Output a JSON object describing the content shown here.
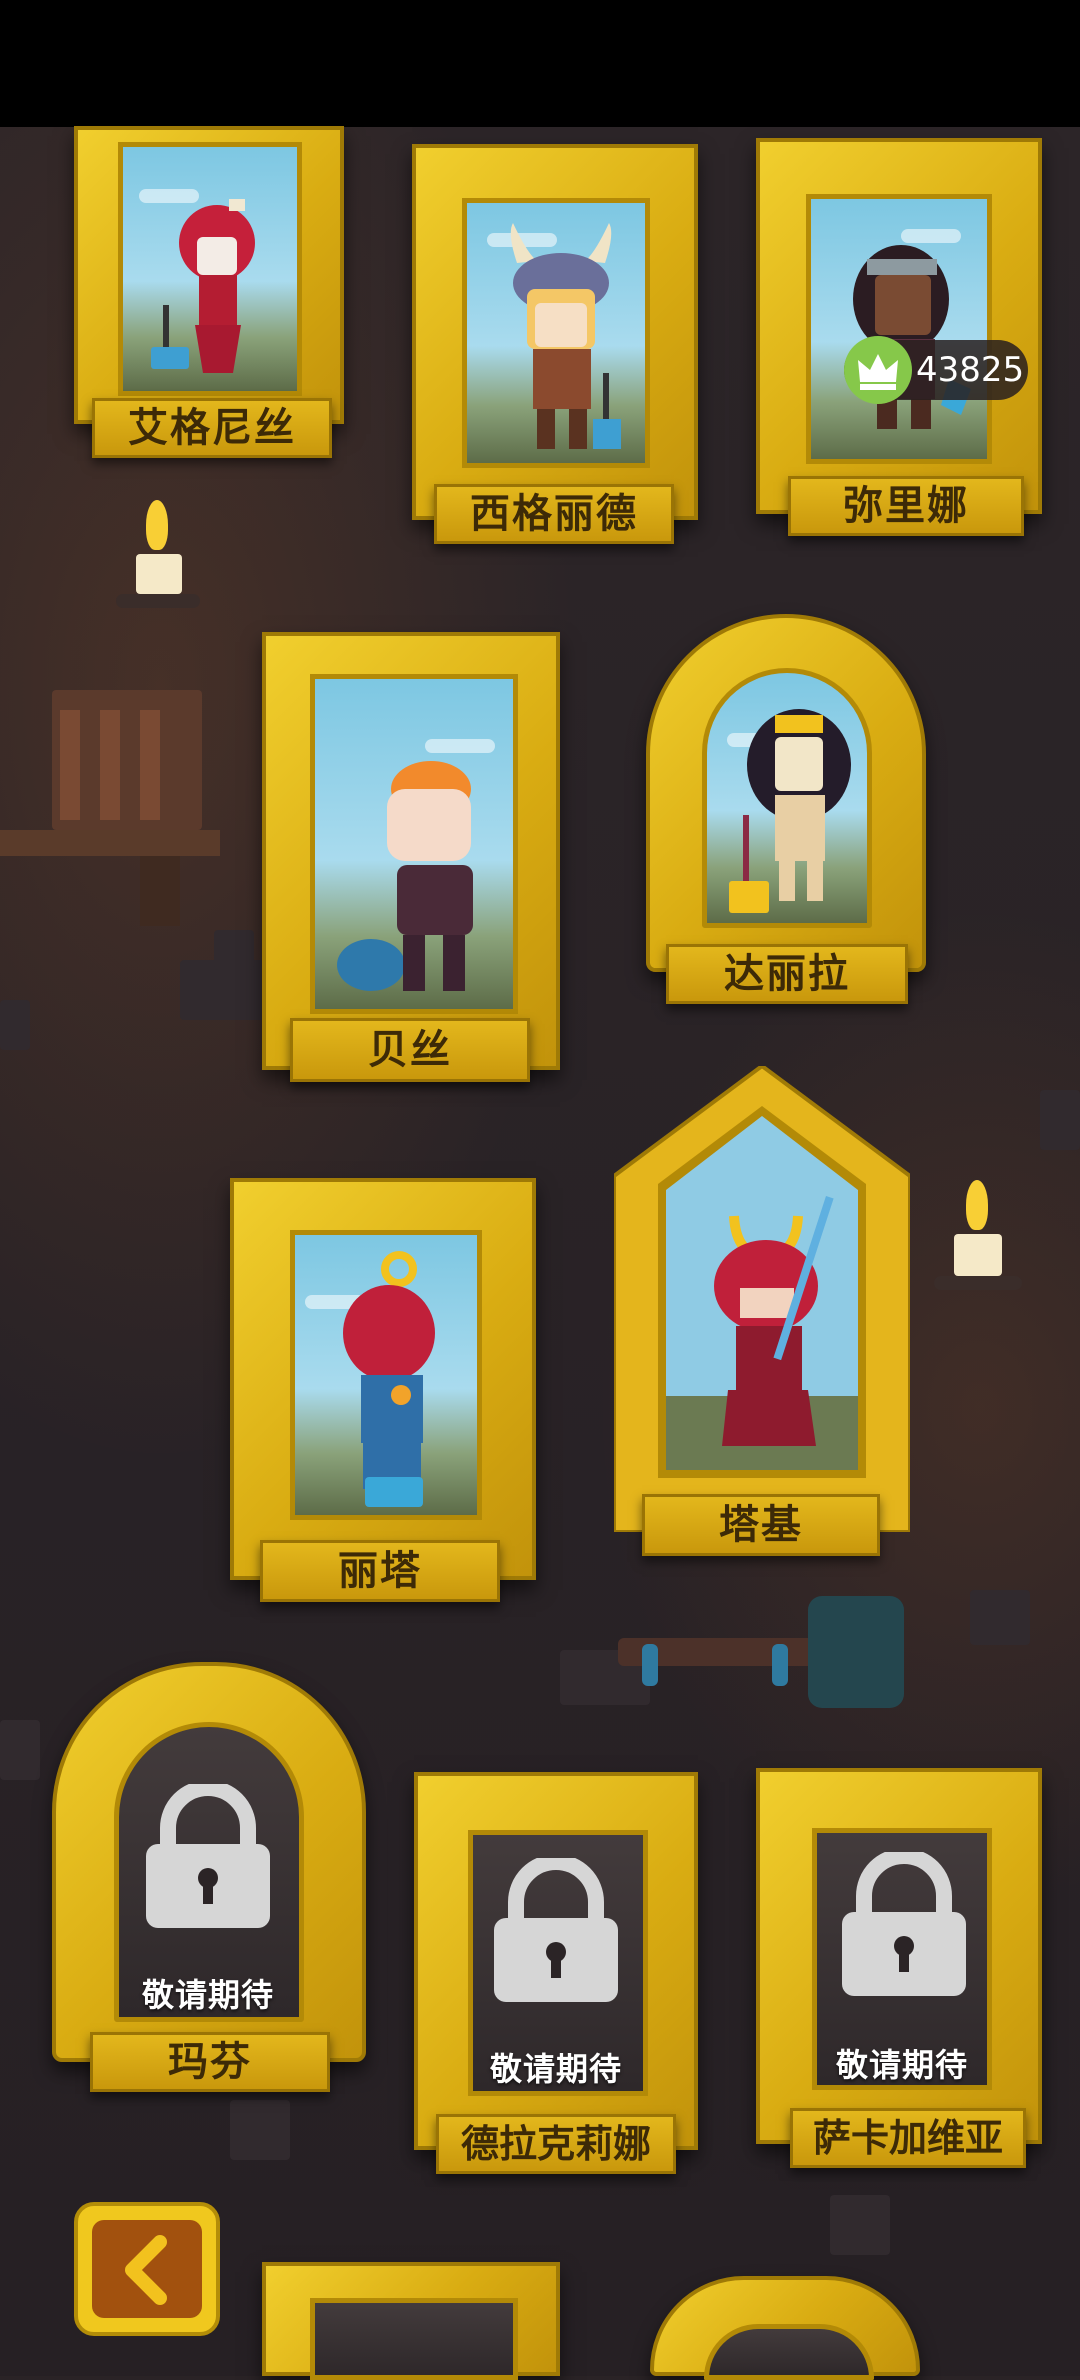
{
  "score": {
    "value": "43825",
    "icon": "crown-icon",
    "accent": "#86c84a"
  },
  "heroes": {
    "aignis": "艾格尼丝",
    "sigrid": "西格丽德",
    "mirina": "弥里娜",
    "bess": "贝丝",
    "dalila": "达丽拉",
    "rita": "丽塔",
    "taki": "塔基",
    "mafen": "玛芬",
    "delakelina": "德拉克莉娜",
    "sakajiaweiya": "萨卡加维亚"
  },
  "locked": {
    "coming_soon": "敬请期待"
  },
  "nav": {
    "back_icon": "chevron-left-icon"
  },
  "colors": {
    "frame_gold": "#e3b71c",
    "wall": "#2a2326",
    "back_button": "#a2510e"
  }
}
